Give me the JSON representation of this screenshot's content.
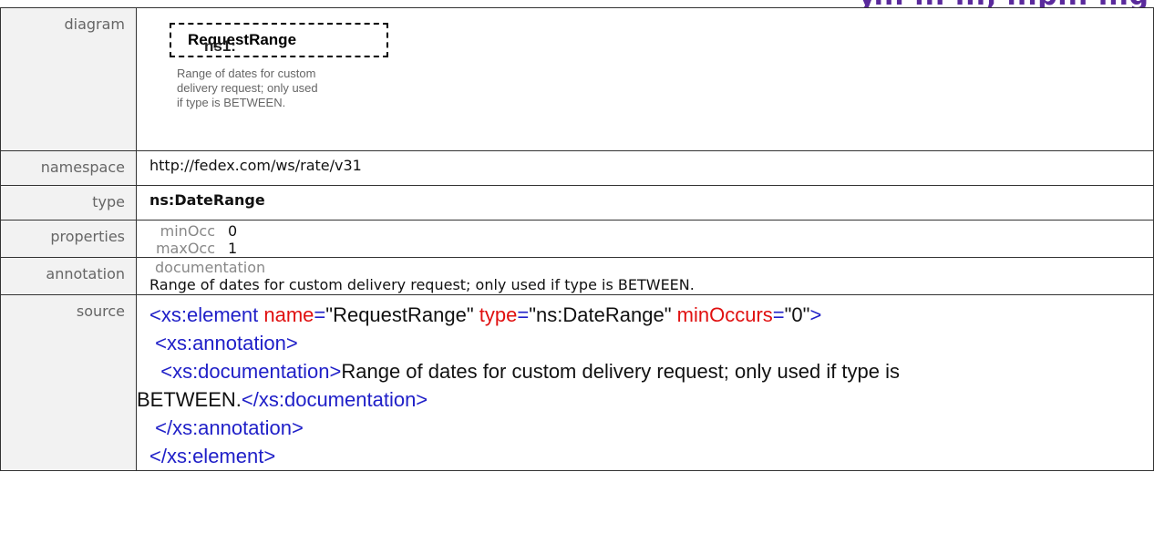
{
  "header": {
    "fragment": "y... ... ...; ...p... ...g"
  },
  "rows": {
    "diagram": {
      "label": "diagram",
      "element_prefix": "ns1:",
      "element_name": "RequestRange",
      "doc": "Range of dates for custom delivery request; only used if type is BETWEEN."
    },
    "namespace": {
      "label": "namespace",
      "value": "http://fedex.com/ws/rate/v31"
    },
    "type": {
      "label": "type",
      "value": "ns:DateRange"
    },
    "properties": {
      "label": "properties",
      "items": [
        {
          "key": "minOcc",
          "value": "0"
        },
        {
          "key": "maxOcc",
          "value": "1"
        }
      ]
    },
    "annotation": {
      "label": "annotation",
      "heading": "documentation",
      "text": "Range of dates for custom delivery request; only used if type is BETWEEN."
    },
    "source": {
      "label": "source",
      "line1": {
        "open": "<xs:element",
        "a1": "name",
        "v1": "\"RequestRange\"",
        "a2": "type",
        "v2": "\"ns:DateRange\"",
        "a3": "minOccurs",
        "v3": "\"0\"",
        "close": ">"
      },
      "line2": " <xs:annotation>",
      "line3_open": "  <xs:documentation>",
      "line3_text": "Range of dates for custom delivery request; only used if type is",
      "line4_text": "BETWEEN.",
      "line4_close": "</xs:documentation>",
      "line5": " </xs:annotation>",
      "line6": "</xs:element>"
    }
  },
  "colors": {
    "tag": "#2020c8",
    "attribute": "#e01010",
    "label_bg": "#f2f2f2",
    "border": "#333333"
  }
}
